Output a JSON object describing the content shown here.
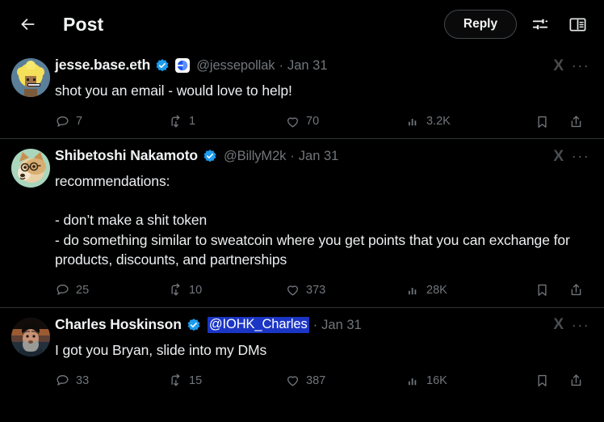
{
  "header": {
    "back_icon": "arrow-left-icon",
    "title": "Post",
    "reply_label": "Reply",
    "sliders_icon": "sliders-icon",
    "reader_icon": "book-reader-icon"
  },
  "colors": {
    "background": "#000000",
    "text_primary": "#e7e9ea",
    "text_secondary": "#71767b",
    "divider": "#2f3336",
    "verified_blue": "#1d9bf0",
    "selection_blue": "#1b35c4",
    "x_logo_gray": "#4a4d50"
  },
  "posts": [
    {
      "display_name": "jesse.base.eth",
      "verified": true,
      "affiliate_badge": "base-logo-icon",
      "handle": "@jessepollak",
      "handle_selected": false,
      "separator": "·",
      "date": "Jan 31",
      "x_logo": "X",
      "more": "···",
      "text": "shot you an email - would love to help!",
      "stats": {
        "replies": "7",
        "reposts": "1",
        "likes": "70",
        "views": "3.2K"
      },
      "avatar": "jesse-base-eth-avatar"
    },
    {
      "display_name": "Shibetoshi Nakamoto",
      "verified": true,
      "affiliate_badge": null,
      "handle": "@BillyM2k",
      "handle_selected": false,
      "separator": "·",
      "date": "Jan 31",
      "x_logo": "X",
      "more": "···",
      "text": "recommendations:\n\n- don’t make a shit token\n- do something similar to sweatcoin where you get points that you can exchange for products, discounts, and partnerships",
      "stats": {
        "replies": "25",
        "reposts": "10",
        "likes": "373",
        "views": "28K"
      },
      "avatar": "shibetoshi-nakamoto-avatar"
    },
    {
      "display_name": "Charles Hoskinson",
      "verified": true,
      "affiliate_badge": null,
      "handle": "@IOHK_Charles",
      "handle_selected": true,
      "separator": "·",
      "date": "Jan 31",
      "x_logo": "X",
      "more": "···",
      "text": "I got you Bryan, slide into my DMs",
      "stats": {
        "replies": "33",
        "reposts": "15",
        "likes": "387",
        "views": "16K"
      },
      "avatar": "charles-hoskinson-avatar"
    }
  ],
  "icon_names": {
    "reply": "comment-icon",
    "repost": "repost-icon",
    "like": "heart-icon",
    "views": "analytics-bars-icon",
    "bookmark": "bookmark-icon",
    "share": "share-upload-icon"
  }
}
